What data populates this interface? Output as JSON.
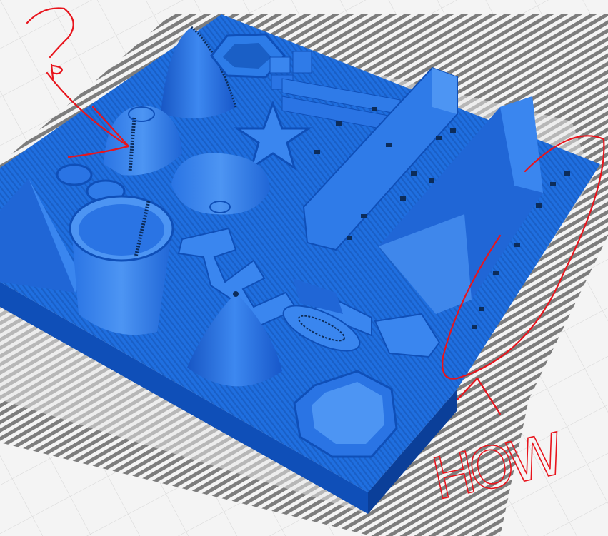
{
  "scene": {
    "colors": {
      "background": "#f4f4f4",
      "grid": "#d6d6d6",
      "skirt": "#8a8a8a",
      "skirt_dark": "#4f4f4f",
      "model": "#1f6fe0",
      "model_light": "#4a92f2",
      "model_dark": "#0f4fb8",
      "model_shadow": "#0b3f99",
      "support": "#0c2c5a",
      "annotation": "#e8141c"
    },
    "objects": [
      "base-plate",
      "cone-tall",
      "dome-with-spiral",
      "hexagon-cutout",
      "star",
      "bowl",
      "cylinder-cup",
      "pyramid-left",
      "cone-small",
      "zigzag-wall",
      "oval-bump",
      "octagon-cup",
      "bridge-rails",
      "ridge-block",
      "overhang-pins"
    ]
  },
  "annotations": {
    "question_mark": "?",
    "handwriting": "HOW"
  }
}
